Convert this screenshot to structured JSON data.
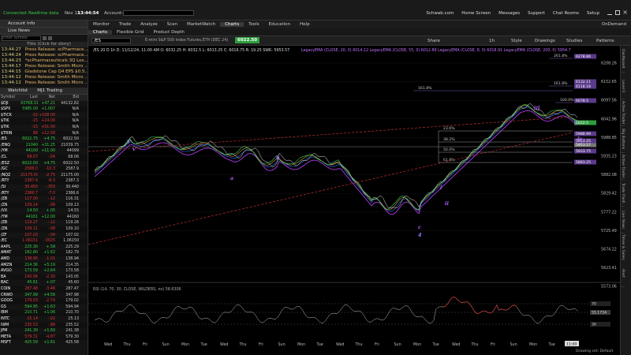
{
  "status": {
    "connected": "Connected",
    "realtime": "Realtime data",
    "date": "Nov 13",
    "time": "13:44:54",
    "account_label": "Account:",
    "links": [
      "Schwab.com",
      "Home Screen",
      "Messages",
      "Support",
      "Chat Rooms",
      "Setup"
    ]
  },
  "left": {
    "account_info": "Account Info",
    "live_news": "Live News",
    "symbol_placeholder": "Enter symbol",
    "news_filter": "Title (Click for story)",
    "news": [
      {
        "time": "13:44:27",
        "headline": "Press Release: scPharmace..."
      },
      {
        "time": "13:44:24",
        "headline": "Press Release: scPharmace..."
      },
      {
        "time": "13:44:23",
        "headline": "*scPharmaceuticals 3Q Los..."
      },
      {
        "time": "13:44:17",
        "headline": "Press Release: Smith Micro ..."
      },
      {
        "time": "13:44:15",
        "headline": "Gladstone Cap Q4 EPS $0.5..."
      },
      {
        "time": "13:44:12",
        "headline": "Press Release: Smith Micro ..."
      },
      {
        "time": "13:44:12",
        "headline": "Press Release: Smith Micro ..."
      }
    ],
    "watchlist_label": "Watchlist",
    "watchlist_name": "MJ1 Trading",
    "cols": [
      "Symbol",
      "Last",
      "Net",
      "Bid"
    ],
    "rows": [
      [
        "$DJI",
        "43768.31",
        "+47.21",
        "44132.82",
        "up"
      ],
      [
        "$SPX",
        "5985.00",
        "+1.007",
        "N/A",
        "up"
      ],
      [
        "$TICK",
        "-32",
        "+108.00",
        "N/A",
        "dn"
      ],
      [
        "$TIK",
        "-15",
        "+14.00",
        "N/A",
        "dn"
      ],
      [
        "$TIK",
        "-15",
        "+51.00",
        "N/A",
        "dn"
      ],
      [
        "$TRIN",
        "88",
        "+12.00",
        "N/A",
        "dn"
      ],
      [
        "/ES",
        "6022.75",
        "+4.75",
        "6022.50",
        "up"
      ],
      [
        "/ENQ",
        "21040",
        "+31.25",
        "21039.75",
        "up"
      ],
      [
        "/YM",
        "44100",
        "+11.00",
        "44099",
        "up"
      ],
      [
        "/CL",
        "68.07",
        "-.04",
        "68.06",
        "dn"
      ],
      [
        "/ESZ",
        "6022.50",
        "+4.75",
        "6022.50",
        "up"
      ],
      [
        "/GC",
        "2588.0",
        "-10.3",
        "2587.9",
        "dn"
      ],
      [
        "/NQZ",
        "21175.50",
        "-2.75",
        "21175.00",
        "dn"
      ],
      [
        "/RTY",
        "2387.4",
        "-6.3",
        "2387.3",
        "dn"
      ],
      [
        "/SI",
        "30.450",
        "-.350",
        "30.440",
        "dn"
      ],
      [
        "/RTY",
        "2386.7",
        "-7.0",
        "2386.6",
        "dn"
      ],
      [
        "/ZB",
        "117.00",
        "-.12",
        "116.31",
        "dn"
      ],
      [
        "/ZN",
        "109.14",
        "-.08",
        "109.13",
        "dn"
      ],
      [
        "/VX",
        "14.50",
        "+.05",
        "14.55",
        "up"
      ],
      [
        "/YM",
        "44161",
        "+12.00",
        "44160",
        "up"
      ],
      [
        "/ZB",
        "119.27",
        "-.12",
        "119.26",
        "dn"
      ],
      [
        "/ZN",
        "109.11",
        "-.08",
        "109.10",
        "dn"
      ],
      [
        "/ZF",
        "107.03",
        "-.04",
        "107.02",
        "dn"
      ],
      [
        "/EC",
        "1.06151",
        "-.0025",
        "1.06150",
        "dn"
      ],
      [
        "AAPL",
        "225.30",
        "+.58",
        "225.29",
        "up"
      ],
      [
        "AMAT",
        "182.80",
        "+1.62",
        "182.79",
        "up"
      ],
      [
        "AMD",
        "138.95",
        "-1.01",
        "138.94",
        "dn"
      ],
      [
        "AMZN",
        "214.36",
        "+5.19",
        "214.35",
        "up"
      ],
      [
        "AVGO",
        "173.59",
        "+2.64",
        "173.58",
        "up"
      ],
      [
        "BA",
        "143.06",
        "-2.30",
        "143.05",
        "dn"
      ],
      [
        "BAC",
        "45.61",
        "+.07",
        "45.60",
        "up"
      ],
      [
        "COIN",
        "287.48",
        "-3.46",
        "287.47",
        "dn"
      ],
      [
        "CRWD",
        "347.99",
        "+4.56",
        "347.98",
        "up"
      ],
      [
        "GOOG",
        "179.03",
        "-2.74",
        "179.02",
        "dn"
      ],
      [
        "GS",
        "594.95",
        "+1.63",
        "594.94",
        "up"
      ],
      [
        "IBM",
        "210.71",
        "+1.06",
        "210.70",
        "up"
      ],
      [
        "INTC",
        "25.14",
        "-.02",
        "25.13",
        "dn"
      ],
      [
        "IWM",
        "235.53",
        "-.88",
        "235.52",
        "dn"
      ],
      [
        "JPM",
        "241.39",
        "+1.60",
        "241.38",
        "up"
      ],
      [
        "META",
        "579.31",
        "-4.87",
        "579.30",
        "dn"
      ],
      [
        "MSFT",
        "425.59",
        "+1.61",
        "425.58",
        "up"
      ]
    ]
  },
  "chart_header": {
    "tabs": [
      "Monitor",
      "Trade",
      "Analyze",
      "Scan",
      "MarketWatch",
      "Charts",
      "Tools",
      "Education",
      "Help"
    ],
    "ondemand": "OnDemand",
    "subtabs": [
      "Charts",
      "Flexible Grid",
      "Product Depth"
    ],
    "symbol": "/ES",
    "description": "E-mini S&P 500 Index Futures,ETH (DEC 24)",
    "price_badge": "6022.50",
    "tools": [
      "Share",
      "Style",
      "Drawings",
      "Studies",
      "Patterns"
    ],
    "timeframe": "1h",
    "ohlc": "/ES 20 D 1h  D: 11/12/24, 11:00 AM  O: 6032.25  H: 6032.5  L: 6013.25  C: 6016.75  R: 19.25  SWK: 5953.57",
    "studies": "LegacyEMA (CLOSE, 20, 0) 6014.12   LegacyEMA (CLOSE, 55, 0) 6012.89   LegacyEMA (CLOSE, 8, 0) 6018.91   LegacyEMA (CLOSE, 200, 0) 5954.7",
    "rsi": "RSI (14, 70, 30, CLOSE, WILDERS, no)  58.6306",
    "rsi_levels": [
      "30",
      "70"
    ],
    "drawing_set": "Drawing set: Default"
  },
  "price_axis": [
    {
      "v": "6208.26"
    },
    {
      "v": "6152.65"
    },
    {
      "v": "6097.56"
    },
    {
      "v": "6042.96"
    },
    {
      "v": "5988.85"
    },
    {
      "v": "5935.23"
    },
    {
      "v": "5882.08"
    },
    {
      "v": "5829.42"
    },
    {
      "v": "5777.22"
    },
    {
      "v": "5725.49"
    },
    {
      "v": "5674.22"
    },
    {
      "v": "5623.41"
    },
    {
      "v": "5573.06"
    }
  ],
  "price_tags": [
    {
      "v": "6278.86",
      "c": "#5a3a8a"
    },
    {
      "v": "6132.11",
      "c": "#5a3a8a"
    },
    {
      "v": "6118.18",
      "c": "#5a3a8a"
    },
    {
      "v": "6078.5",
      "c": "#5a3a8a"
    },
    {
      "v": "6022.5",
      "c": "#2e9e3e"
    },
    {
      "v": "5988.99",
      "c": "#5a3a8a"
    },
    {
      "v": "5953.57",
      "c": "#777777"
    },
    {
      "v": "5953.25",
      "c": "#5a3a8a"
    },
    {
      "v": "5933.75",
      "c": "#5a3a8a"
    },
    {
      "v": "5883.25",
      "c": "#5a3a8a"
    }
  ],
  "fib_labels": [
    {
      "t": "261.8%",
      "c": "#c8c8c8"
    },
    {
      "t": "161.8%",
      "c": "#c8c8c8"
    },
    {
      "t": "161.8%",
      "c": "#c8c8c8"
    },
    {
      "t": "100.0%",
      "c": "#c8c8c8"
    },
    {
      "t": "23.6%",
      "c": "#c8c8c8"
    },
    {
      "t": "38.2%",
      "c": "#c8c8c8"
    },
    {
      "t": "50.0%",
      "c": "#c8c8c8"
    },
    {
      "t": "61.8%",
      "c": "#c8c8c8"
    }
  ],
  "wave_labels": [
    {
      "t": "3",
      "c": "#8080ff"
    },
    {
      "t": "v",
      "c": "#b060ff"
    },
    {
      "t": "a",
      "c": "#b060ff"
    },
    {
      "t": "b",
      "c": "#b060ff"
    },
    {
      "t": "c",
      "c": "#b060ff"
    },
    {
      "t": "4",
      "c": "#8080ff"
    },
    {
      "t": "i",
      "c": "#b060ff"
    },
    {
      "t": "ii",
      "c": "#b060ff"
    },
    {
      "t": "iii",
      "c": "#b060ff"
    },
    {
      "t": "iv",
      "c": "#b060ff"
    }
  ],
  "rsi_tags": [
    {
      "v": "70",
      "c": "#555"
    },
    {
      "v": "55.1734",
      "c": "#555"
    },
    {
      "v": "30",
      "c": "#555"
    }
  ],
  "x_axis": [
    "Wed",
    "Thu",
    "Fri",
    "Sun",
    "Mon",
    "Tue",
    "Wed",
    "Thu",
    "Fri",
    "Sun",
    "Mon",
    "Tue",
    "Wed",
    "Thu",
    "Fri",
    "Sun",
    "Mon",
    "Tue",
    "Wed",
    "Thu",
    "Fri",
    "Sun",
    "Mon",
    "Tue",
    "Wed"
  ],
  "x_tag": "11:00",
  "right_tabs": [
    "Dashboard",
    "Level II",
    "Active Trader",
    "Big Buttons",
    "Active Trader",
    "Trade Flash",
    "Live News",
    "Times & Sales",
    "Alert"
  ]
}
